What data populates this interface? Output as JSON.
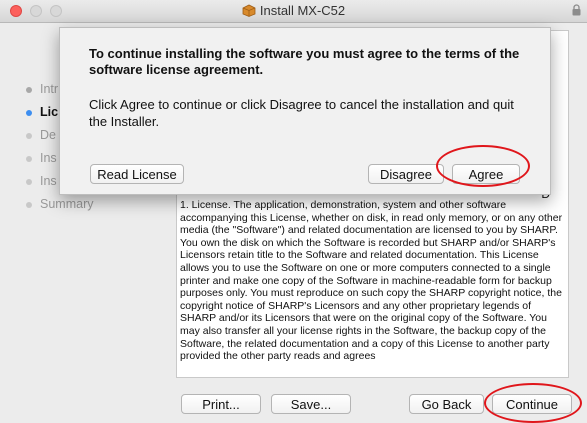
{
  "window": {
    "title": "Install MX-C52",
    "title_icon": "package-icon",
    "lock_icon": "lock-icon"
  },
  "sidebar": {
    "steps": [
      {
        "label": "Intr",
        "state": "done"
      },
      {
        "label": "Lic",
        "state": "active"
      },
      {
        "label": "De",
        "state": "pending"
      },
      {
        "label": "Ins",
        "state": "pending"
      },
      {
        "label": "Ins",
        "state": "pending"
      },
      {
        "label": "Summary",
        "state": "pending"
      }
    ]
  },
  "content": {
    "fragment": "D",
    "license_text": "1. License.  The application, demonstration, system and other software accompanying this License, whether on disk, in read only memory, or on any other media (the \"Software\") and related documentation are licensed to you by SHARP.  You own the disk on which the Software is recorded but SHARP and/or SHARP's Licensors retain title to the Software and related documentation. This License allows you to use the Software on one or more computers connected to a single printer and make one copy of the Software in machine-readable form for backup purposes only.  You must reproduce on such copy the SHARP copyright notice, the copyright notice of SHARP's Licensors and any other proprietary legends of SHARP and/or its Licensors that were on the original copy of the Software. You may also transfer all your license rights in the Software, the backup copy of the Software, the related documentation and a copy of this License to another party provided the other party reads and agrees"
  },
  "dialog": {
    "heading": "To continue installing the software you must agree to the terms of the software license agreement.",
    "body": "Click Agree to continue or click Disagree to cancel the installation and quit the Installer.",
    "read_license": "Read License",
    "disagree": "Disagree",
    "agree": "Agree"
  },
  "buttons": {
    "print": "Print...",
    "save": "Save...",
    "go_back": "Go Back",
    "continue": "Continue"
  },
  "colors": {
    "annotation_ring": "#e0161b",
    "active_step_dot": "#3d8ef0",
    "close_button": "#fc605c"
  }
}
